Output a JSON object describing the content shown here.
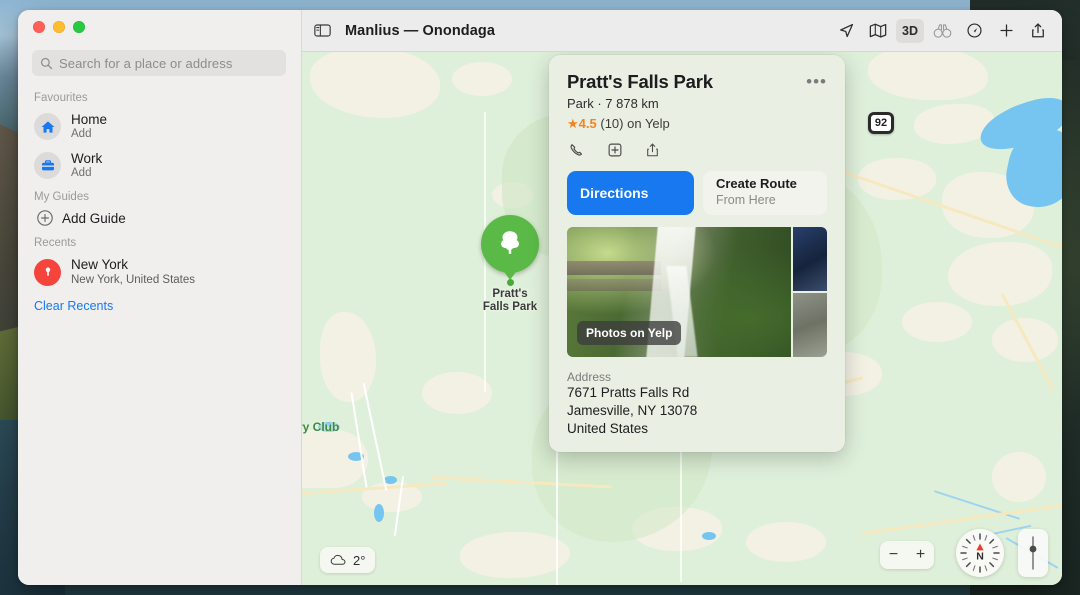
{
  "window": {
    "title": "Manlius — Onondaga",
    "traffic_lights": [
      "close",
      "minimize",
      "zoom"
    ]
  },
  "sidebar": {
    "search": {
      "placeholder": "Search for a place or address",
      "icon": "search-icon"
    },
    "sections": {
      "favourites": "Favourites",
      "my_guides": "My Guides",
      "recents": "Recents"
    },
    "favourites": [
      {
        "title": "Home",
        "subtitle": "Add",
        "icon": "home-icon"
      },
      {
        "title": "Work",
        "subtitle": "Add",
        "icon": "briefcase-icon"
      }
    ],
    "add_guide": {
      "label": "Add Guide",
      "icon": "plus-circle-icon"
    },
    "recents": [
      {
        "title": "New York",
        "subtitle": "New York, United States",
        "icon": "map-pin-icon"
      }
    ],
    "clear_recents": "Clear Recents"
  },
  "toolbar": {
    "sidebar_toggle": "sidebar-toggle-icon",
    "items": [
      {
        "name": "location-arrow-icon",
        "label": ""
      },
      {
        "name": "map-style-icon",
        "label": ""
      },
      {
        "name": "three-d-toggle",
        "label": "3D",
        "active": true
      },
      {
        "name": "binoculars-icon",
        "label": ""
      },
      {
        "name": "compass-rotate-icon",
        "label": ""
      },
      {
        "name": "plus-icon",
        "label": ""
      },
      {
        "name": "share-icon",
        "label": ""
      }
    ]
  },
  "place_card": {
    "title": "Pratt's Falls Park",
    "more_glyph": "•••",
    "subtitle": "Park · 7 878 km",
    "rating": {
      "star": "★",
      "value": "4.5",
      "count": "(10)",
      "source": "on Yelp"
    },
    "actions": [
      {
        "name": "phone-icon"
      },
      {
        "name": "add-to-guide-icon"
      },
      {
        "name": "share-icon"
      }
    ],
    "directions_button": "Directions",
    "create_route": {
      "line1": "Create Route",
      "line2": "From Here"
    },
    "photo_badge": "Photos on Yelp",
    "address_label": "Address",
    "address_lines": [
      "7671 Pratts Falls Rd",
      "Jamesville, NY  13078",
      "United States"
    ]
  },
  "map": {
    "poi": {
      "label_line1": "Pratt's",
      "label_line2": "Falls Park",
      "icon": "tree-icon",
      "color": "#5bba47"
    },
    "route_shield": "92",
    "labels": [
      {
        "text": "ry Club",
        "color": "#3f8a43"
      }
    ],
    "weather": {
      "icon": "cloud-icon",
      "temperature": "2°"
    },
    "controls": {
      "zoom_out": "−",
      "zoom_in": "+",
      "compass_letter": "N",
      "pitch": "pitch-slider"
    },
    "colors": {
      "land": "#f3f1e4",
      "park": "#cfe7c6",
      "water": "#76c5f0",
      "road": "#f7e9bf"
    }
  }
}
